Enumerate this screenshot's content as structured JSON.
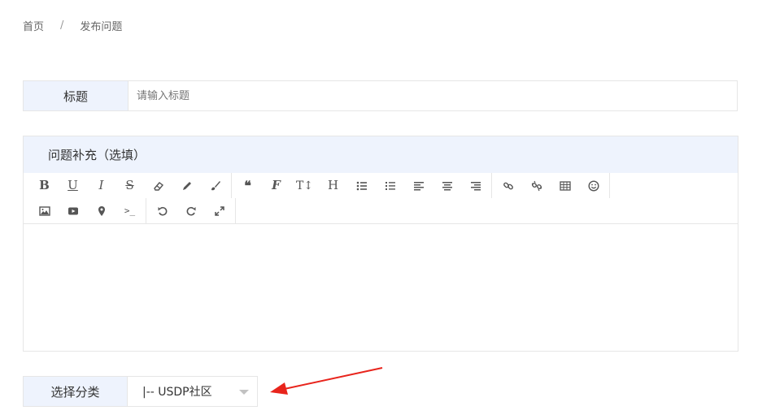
{
  "breadcrumb": {
    "home": "首页",
    "separator": "/",
    "current": "发布问题"
  },
  "title_field": {
    "label": "标题",
    "placeholder": "请输入标题"
  },
  "editor": {
    "header": "问题补充（选填）",
    "toolbar_row1": [
      {
        "name": "bold",
        "glyph": "B"
      },
      {
        "name": "underline",
        "glyph": "U"
      },
      {
        "name": "italic",
        "glyph": "I"
      },
      {
        "name": "strikethrough",
        "glyph": "S"
      },
      {
        "name": "eraser",
        "glyph": ""
      },
      {
        "name": "pencil",
        "glyph": ""
      },
      {
        "name": "brush",
        "glyph": ""
      },
      {
        "name": "quote",
        "glyph": "❝"
      },
      {
        "name": "font",
        "glyph": "F"
      },
      {
        "name": "font-size",
        "glyph": "T↕"
      },
      {
        "name": "heading",
        "glyph": "H"
      },
      {
        "name": "bullet-list",
        "glyph": ""
      },
      {
        "name": "numbered-list",
        "glyph": ""
      },
      {
        "name": "align-left",
        "glyph": ""
      },
      {
        "name": "align-center",
        "glyph": ""
      },
      {
        "name": "align-right",
        "glyph": ""
      },
      {
        "name": "link",
        "glyph": ""
      },
      {
        "name": "unlink",
        "glyph": ""
      },
      {
        "name": "table",
        "glyph": ""
      },
      {
        "name": "emoji",
        "glyph": "☺"
      }
    ],
    "toolbar_row2": [
      {
        "name": "image",
        "glyph": ""
      },
      {
        "name": "video",
        "glyph": ""
      },
      {
        "name": "map-marker",
        "glyph": ""
      },
      {
        "name": "terminal",
        "glyph": ">_"
      },
      {
        "name": "undo",
        "glyph": "↶"
      },
      {
        "name": "redo",
        "glyph": "↷"
      },
      {
        "name": "fullscreen",
        "glyph": "⤢"
      }
    ]
  },
  "category_field": {
    "label": "选择分类",
    "selected": "|-- USDP社区"
  },
  "annotation": {
    "arrow_color": "#e8241c"
  },
  "colors": {
    "label_bg": "#eef3fd",
    "border": "#e6e6e6"
  }
}
